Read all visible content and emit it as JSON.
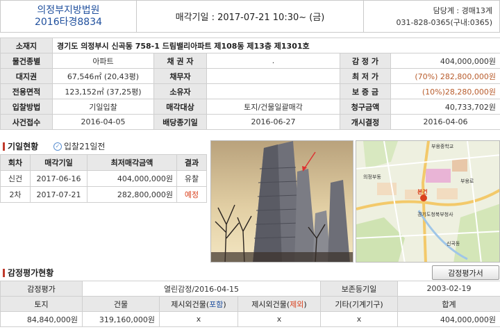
{
  "header": {
    "court": "의정부지방법원",
    "case_no": "2016타경8834",
    "sale_date": "매각기일 : 2017-07-21   10:30~ (금)",
    "dept": "담당계 : 경매13계",
    "phone": "031-828-0365(구내:0365)"
  },
  "info": {
    "address_label": "소재지",
    "address": "경기도 의정부시 신곡동 758-1 드림밸리아파트 제108동 제13층 제1301호",
    "rows": [
      [
        {
          "l": "물건종별"
        },
        {
          "v": "아파트"
        },
        {
          "l": "채 권 자"
        },
        {
          "v": "."
        },
        {
          "l": "감 정 가"
        },
        {
          "v": "404,000,000원"
        }
      ],
      [
        {
          "l": "대지권"
        },
        {
          "v": "67,546㎡ (20,43평)"
        },
        {
          "l": "채무자"
        },
        {
          "v": ""
        },
        {
          "l": "최 저 가"
        },
        {
          "v": "(70%) 282,800,000원"
        }
      ],
      [
        {
          "l": "전용면적"
        },
        {
          "v": "123,152㎡ (37,25평)"
        },
        {
          "l": "소유자"
        },
        {
          "v": ""
        },
        {
          "l": "보 증 금"
        },
        {
          "v": "(10%)28,280,000원"
        }
      ],
      [
        {
          "l": "입찰방법"
        },
        {
          "v": "기일입찰"
        },
        {
          "l": "매각대상"
        },
        {
          "v": "토지/건물일괄매각"
        },
        {
          "l": "청구금액"
        },
        {
          "v": "40,733,702원"
        }
      ],
      [
        {
          "l": "사건접수"
        },
        {
          "v": "2016-04-05"
        },
        {
          "l": "배당종기일"
        },
        {
          "v": "2016-06-27"
        },
        {
          "l": "개시결정"
        },
        {
          "v": "2016-04-06"
        }
      ]
    ]
  },
  "bid": {
    "title": "기일현황",
    "days": "입찰21일전",
    "headers": [
      "회차",
      "매각기일",
      "최저매각금액",
      "결과"
    ],
    "rows": [
      [
        "신건",
        "2017-06-16",
        "404,000,000원",
        "유찰"
      ],
      [
        "2차",
        "2017-07-21",
        "282,800,000원",
        "예정"
      ]
    ]
  },
  "map": {
    "labels": [
      "부용중학교",
      "의정부동",
      "부용로",
      "경기도청북부청사",
      "신곡동",
      "본건"
    ]
  },
  "appraisal": {
    "title": "감정평가현황",
    "button": "감정평가서",
    "row1": {
      "l1": "감정평가",
      "v1": "열린감정/2016-04-15",
      "l2": "보존등기일",
      "v2": "2003-02-19"
    },
    "headers": [
      "토지",
      "건물",
      "제시외건물(",
      "포함",
      ")",
      "제시외건물(",
      "제외",
      ")",
      "기타(기계기구)",
      "합계"
    ],
    "values": [
      "84,840,000원",
      "319,160,000원",
      "x",
      "x",
      "x",
      "404,000,000원"
    ]
  },
  "colors": {
    "accent": "#1f4f9d",
    "red": "#d9411e",
    "label_bg": "#e8e8e8"
  }
}
